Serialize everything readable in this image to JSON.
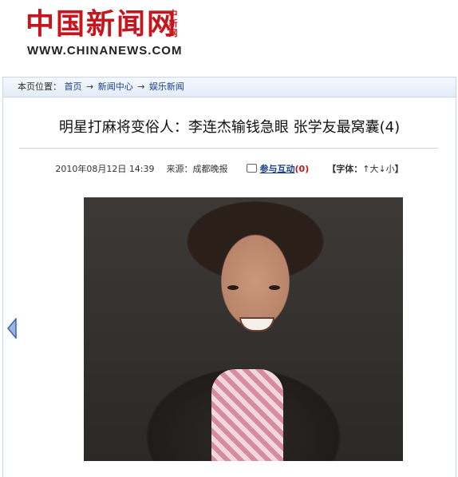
{
  "header": {
    "logo_cn": "中国新闻网",
    "logo_side": [
      "中",
      "新",
      "网"
    ],
    "logo_en": "WWW.CHINANEWS.COM"
  },
  "breadcrumb": {
    "label": "本页位置：",
    "items": [
      "首页",
      "新闻中心",
      "娱乐新闻"
    ],
    "separator": "→"
  },
  "article": {
    "title": "明星打麻将变俗人：李连杰输钱急眼 张学友最窝囊(4)",
    "date": "2010年08月12日 14:39",
    "source": "来源：成都晚报",
    "interact_label": "参与互动",
    "interact_count_open": "(",
    "interact_count": "0",
    "interact_count_close": ")",
    "font_prefix": "【字体：",
    "font_larger": "↑大",
    "font_smaller": "↓小",
    "font_suffix": "】"
  },
  "colors": {
    "brand_red": "#c4161c",
    "link_blue": "#1a3f8a",
    "crumb_bar": "#e3ecf7"
  },
  "icons": [
    "comment-icon",
    "left-arrow-icon"
  ]
}
